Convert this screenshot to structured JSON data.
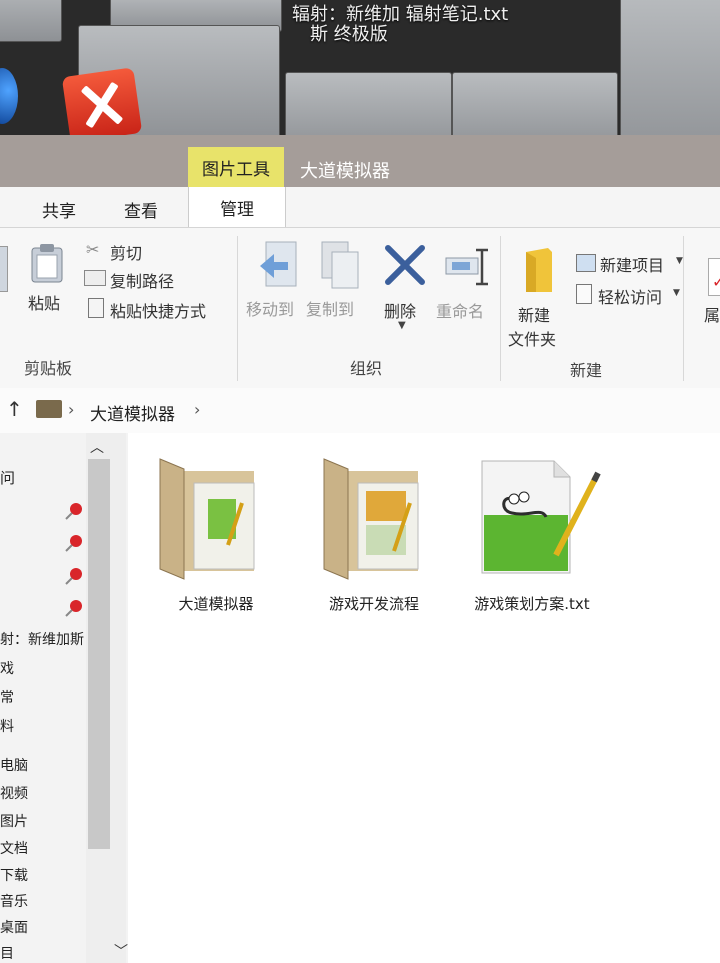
{
  "desktop": {
    "caption_line1": "辐射：新维加  辐射笔记.txt",
    "caption_line2": "斯 终极版"
  },
  "window": {
    "tool_tab": "图片工具",
    "title": "大道模拟器"
  },
  "tabs": {
    "share": "共享",
    "view": "查看",
    "manage": "管理"
  },
  "ribbon": {
    "clipboard": {
      "label": "剪贴板",
      "paste": "粘贴",
      "cut": "剪切",
      "copy_path": "复制路径",
      "paste_shortcut": "粘贴快捷方式"
    },
    "organize": {
      "label": "组织",
      "move_to": "移动到",
      "copy_to": "复制到",
      "delete": "删除",
      "rename": "重命名"
    },
    "new": {
      "label": "新建",
      "new_folder_line1": "新建",
      "new_folder_line2": "文件夹",
      "new_item": "新建项目",
      "easy_access": "轻松访问"
    },
    "open": {
      "properties_partial": "属"
    }
  },
  "address": {
    "up_arrow": "↑",
    "crumb": "大道模拟器"
  },
  "nav": {
    "items": [
      {
        "label": "问"
      },
      {
        "label": "射：新维加斯"
      },
      {
        "label": "戏"
      },
      {
        "label": "常"
      },
      {
        "label": "料"
      },
      {
        "label": "电脑"
      },
      {
        "label": "视频"
      },
      {
        "label": "图片"
      },
      {
        "label": "文档"
      },
      {
        "label": "下载"
      },
      {
        "label": "音乐"
      },
      {
        "label": "桌面"
      },
      {
        "label": "目"
      }
    ]
  },
  "files": [
    {
      "name": "大道模拟器",
      "type": "folder"
    },
    {
      "name": "游戏开发流程",
      "type": "folder"
    },
    {
      "name": "游戏策划方案.txt",
      "type": "notepad-document"
    }
  ],
  "colors": {
    "tool_tab": "#e8e36a",
    "titlebar": "#a59d99",
    "delete_x": "#3b5f9c",
    "folder_yellow": "#f0c43a",
    "pin_red": "#d9252a"
  }
}
